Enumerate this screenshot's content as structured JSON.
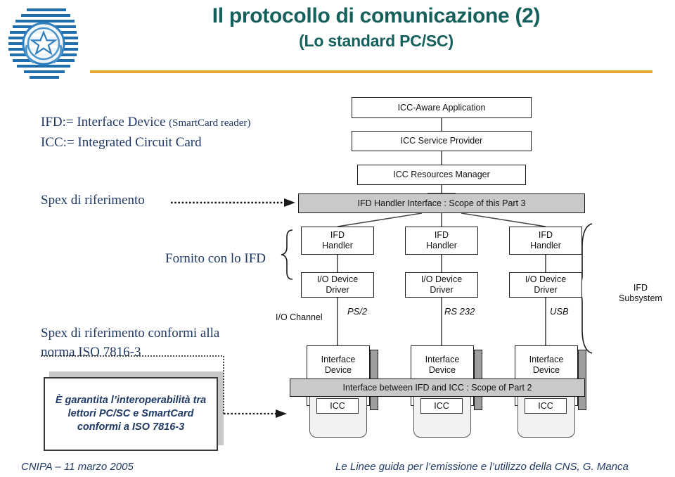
{
  "slide": {
    "title_main": "Il protocollo di comunicazione (2)",
    "title_sub": "(Lo standard PC/SC)",
    "accent_color": "#15605C",
    "rule_color": "#E8A62C",
    "text_color": "#1F3864"
  },
  "legend": {
    "line1_a": "IFD:= Interface Device ",
    "line1_b": "(SmartCard reader)",
    "line2": "ICC:= Integrated Circuit Card"
  },
  "annotations": {
    "spex_riferimento": "Spex di riferimento",
    "fornito_con_ifd": "Fornito con lo IFD",
    "spex_conformi": "Spex di riferimento conformi alla norma ISO 7816-3",
    "callout": "È garantita l’interoperabilità tra lettori PC/SC e SmartCard conformi a ISO 7816-3",
    "ifd_subsystem": "IFD Subsystem",
    "io_channel": "I/O Channel"
  },
  "diagram": {
    "stack": [
      "ICC-Aware Application",
      "ICC Service Provider",
      "ICC Resources Manager"
    ],
    "scope_part3": "IFD Handler Interface : Scope of this Part 3",
    "scope_part2": "Interface between IFD and ICC : Scope of Part 2",
    "columns": [
      {
        "handler": "IFD Handler",
        "driver": "I/O Device Driver",
        "bus": "PS/2",
        "device": "Interface Device",
        "card": "ICC"
      },
      {
        "handler": "IFD Handler",
        "driver": "I/O Device Driver",
        "bus": "RS 232",
        "device": "Interface Device",
        "card": "ICC"
      },
      {
        "handler": "IFD Handler",
        "driver": "I/O Device Driver",
        "bus": "USB",
        "device": "Interface Device",
        "card": "ICC"
      }
    ]
  },
  "footer": {
    "left": "CNIPA – 11 marzo 2005",
    "right": "Le Linee guida per l’emissione e l’utilizzo della CNS, G. Manca"
  }
}
